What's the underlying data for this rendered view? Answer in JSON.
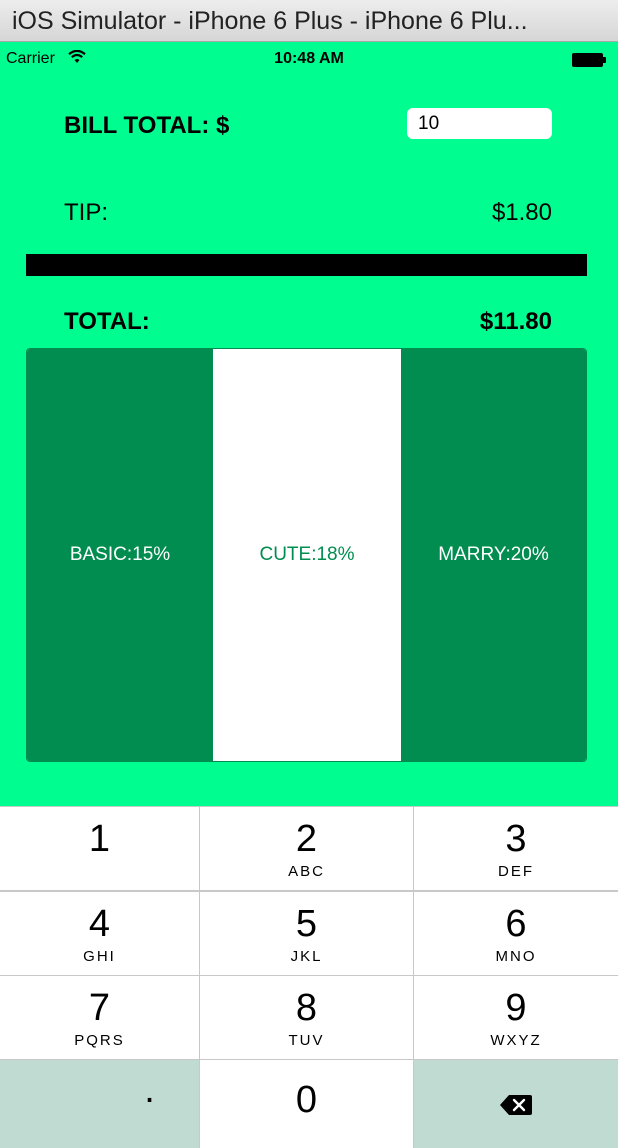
{
  "window": {
    "title": "iOS Simulator - iPhone 6 Plus - iPhone 6 Plu..."
  },
  "status_bar": {
    "carrier": "Carrier",
    "time": "10:48 AM",
    "wifi_icon": "wifi-icon",
    "battery_icon": "battery-icon"
  },
  "bill": {
    "label": "BILL TOTAL: $",
    "value": "10"
  },
  "tip": {
    "label": "TIP:",
    "value": "$1.80"
  },
  "total": {
    "label": "TOTAL:",
    "value": "$11.80"
  },
  "segments": [
    {
      "label": "BASIC:15%",
      "selected": false
    },
    {
      "label": "CUTE:18%",
      "selected": true
    },
    {
      "label": "MARRY:20%",
      "selected": false
    }
  ],
  "keypad": {
    "keys": [
      {
        "num": "1",
        "letters": ""
      },
      {
        "num": "2",
        "letters": "ABC"
      },
      {
        "num": "3",
        "letters": "DEF"
      },
      {
        "num": "4",
        "letters": "GHI"
      },
      {
        "num": "5",
        "letters": "JKL"
      },
      {
        "num": "6",
        "letters": "MNO"
      },
      {
        "num": "7",
        "letters": "PQRS"
      },
      {
        "num": "8",
        "letters": "TUV"
      },
      {
        "num": "9",
        "letters": "WXYZ"
      }
    ],
    "dot": ".",
    "zero": "0",
    "delete_icon": "backspace-icon"
  },
  "colors": {
    "background": "#00fd90",
    "segment_active": "#008d4f",
    "segment_inactive": "#ffffff",
    "keypad_dark_key": "#bfdbd2"
  }
}
